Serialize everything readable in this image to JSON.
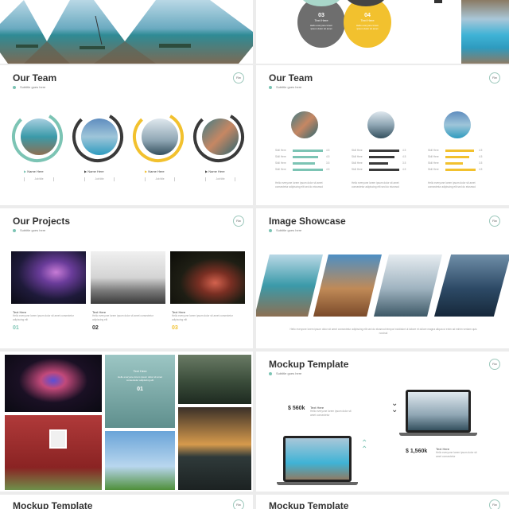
{
  "slide1": {
    "circles": [
      {
        "number": "03",
        "label": "Text Here",
        "body": "Hello everyone lorem ipsum dolor sit amet"
      },
      {
        "number": "04",
        "label": "Text Here",
        "body": "Hello everyone lorem ipsum dolor sit amet"
      }
    ]
  },
  "team1": {
    "title": "Our Team",
    "subtitle": "Subtitle goes here",
    "logo": "Rw",
    "members": [
      {
        "name": "Name Here",
        "role": "Job title"
      },
      {
        "name": "Name Here",
        "role": "Job title"
      },
      {
        "name": "Name Here",
        "role": "Job title"
      },
      {
        "name": "Name Here",
        "role": "Job title"
      }
    ]
  },
  "team2": {
    "title": "Our Team",
    "subtitle": "Subtitle goes here",
    "logo": "Rw",
    "bar_labels": [
      "Skill Here",
      "Skill Here",
      "Skill Here",
      "Skill Here"
    ],
    "bar_values": [
      "4.5",
      "4.5",
      "3.5",
      "4.5"
    ],
    "bar_levels": [
      [
        0.95,
        0.8,
        0.7,
        0.95
      ],
      [
        0.95,
        0.8,
        0.6,
        0.95
      ],
      [
        0.9,
        0.75,
        0.55,
        0.95
      ]
    ],
    "desc": "Hello everyone lorem ipsum dolor sit amet consectetur adipiscing elit sed do eiusmod"
  },
  "projects": {
    "title": "Our Projects",
    "subtitle": "Subtitle goes here",
    "logo": "Rw",
    "items": [
      {
        "label": "Text Here",
        "body": "Hello everyone lorem ipsum dolor sit amet consectetur adipiscing elit",
        "num": "01"
      },
      {
        "label": "Text Here",
        "body": "Hello everyone lorem ipsum dolor sit amet consectetur adipiscing elit",
        "num": "02"
      },
      {
        "label": "Text Here",
        "body": "Hello everyone lorem ipsum dolor sit amet consectetur adipiscing elit",
        "num": "03"
      }
    ]
  },
  "showcase": {
    "title": "Image Showcase",
    "subtitle": "Subtitle goes here",
    "logo": "Rw",
    "caption": "Hello everyone lorem ipsum dolor sit amet consectetur adipiscing elit sed do eiusmod tempor incididunt ut labore et dolore magna aliqua ut enim ad minim veniam quis nostrud"
  },
  "gallery": {
    "label": "Text Here",
    "body": "Hello everyone lorem ipsum dolor sit amet consectetur adipiscing elit",
    "num": "01"
  },
  "mockup": {
    "title": "Mockup Template",
    "subtitle": "Subtitle goes here",
    "logo": "Rw",
    "price1": "$ 560k",
    "price2": "$ 1,560k",
    "label1": "Text Here",
    "label2": "Text Here",
    "body": "Hello everyone lorem ipsum dolor sit amet consectetur"
  },
  "bottom": {
    "left_title": "Mockup Template",
    "right_title": "Mockup Template",
    "logo": "Rw"
  },
  "colors": {
    "teal": "#7cc4b4",
    "yellow": "#f2c12e",
    "dark": "#3a3a3a"
  }
}
